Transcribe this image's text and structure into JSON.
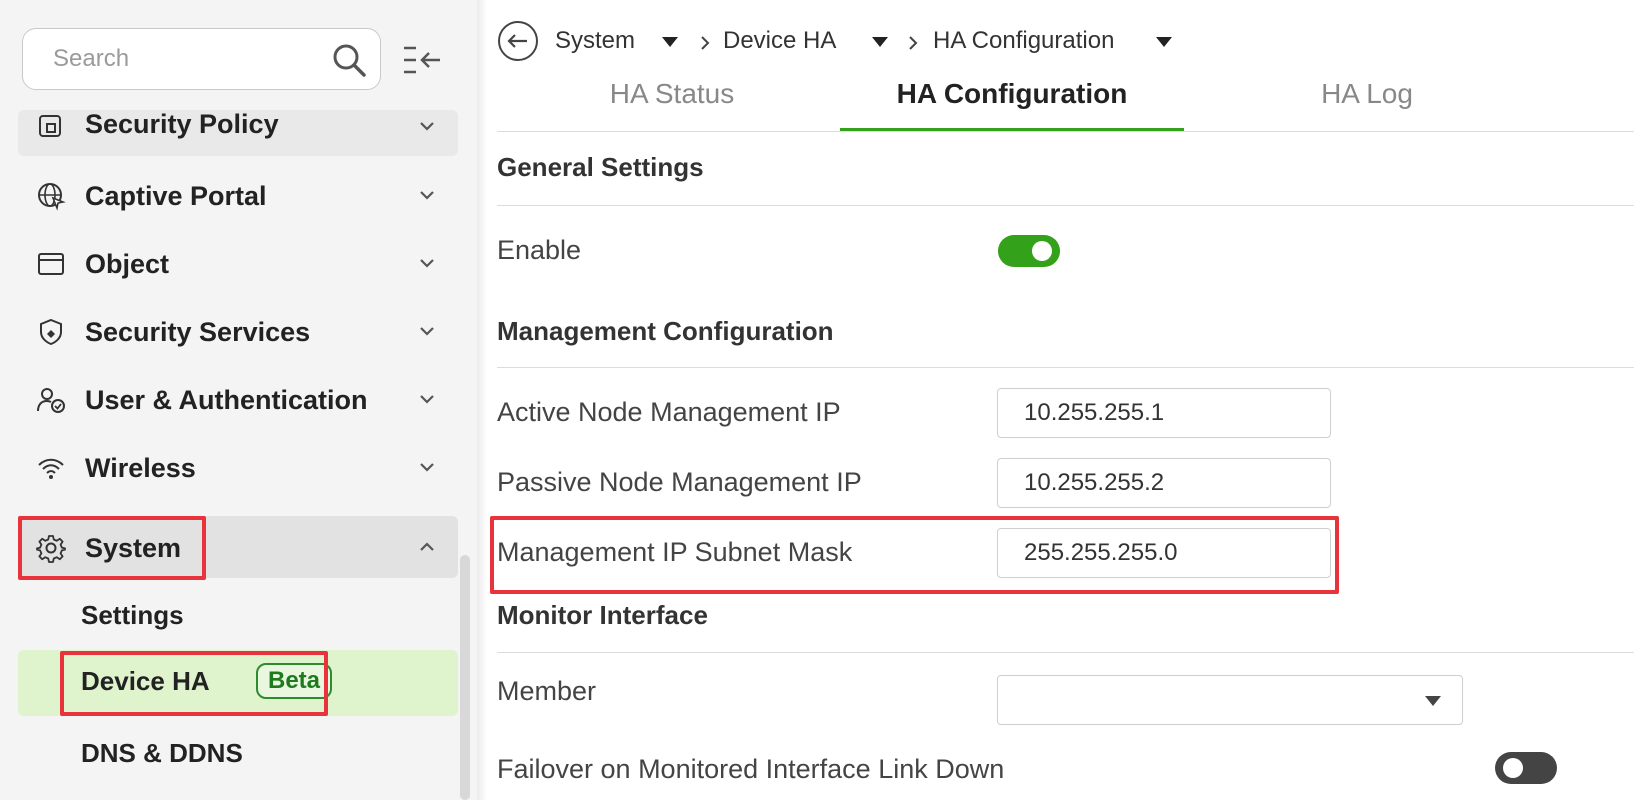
{
  "sidebar": {
    "search_placeholder": "Search",
    "items": [
      {
        "label": "Security Policy",
        "icon": "security-policy-icon"
      },
      {
        "label": "Captive Portal",
        "icon": "captive-portal-icon"
      },
      {
        "label": "Object",
        "icon": "object-icon"
      },
      {
        "label": "Security Services",
        "icon": "shield-icon"
      },
      {
        "label": "User & Authentication",
        "icon": "user-icon"
      },
      {
        "label": "Wireless",
        "icon": "wifi-icon"
      },
      {
        "label": "System",
        "icon": "gear-icon"
      }
    ],
    "sub_items": [
      {
        "label": "Settings"
      },
      {
        "label": "Device HA",
        "badge": "Beta"
      },
      {
        "label": "DNS & DDNS"
      }
    ]
  },
  "breadcrumb": [
    "System",
    "Device HA",
    "HA Configuration"
  ],
  "tabs": [
    {
      "label": "HA Status"
    },
    {
      "label": "HA Configuration"
    },
    {
      "label": "HA Log"
    }
  ],
  "general": {
    "title": "General Settings",
    "enable_label": "Enable",
    "enabled": true
  },
  "management": {
    "title": "Management Configuration",
    "active_ip_label": "Active Node Management IP",
    "active_ip": "10.255.255.1",
    "passive_ip_label": "Passive Node Management IP",
    "passive_ip": "10.255.255.2",
    "subnet_label": "Management IP Subnet Mask",
    "subnet": "255.255.255.0"
  },
  "monitor": {
    "title": "Monitor Interface",
    "member_label": "Member",
    "member_value": "",
    "failover_label": "Failover on Monitored Interface Link Down",
    "failover_enabled": false
  },
  "colors": {
    "accent_green": "#34a11a",
    "highlight_red": "#e8323c",
    "active_bg": "#dff3cd"
  }
}
